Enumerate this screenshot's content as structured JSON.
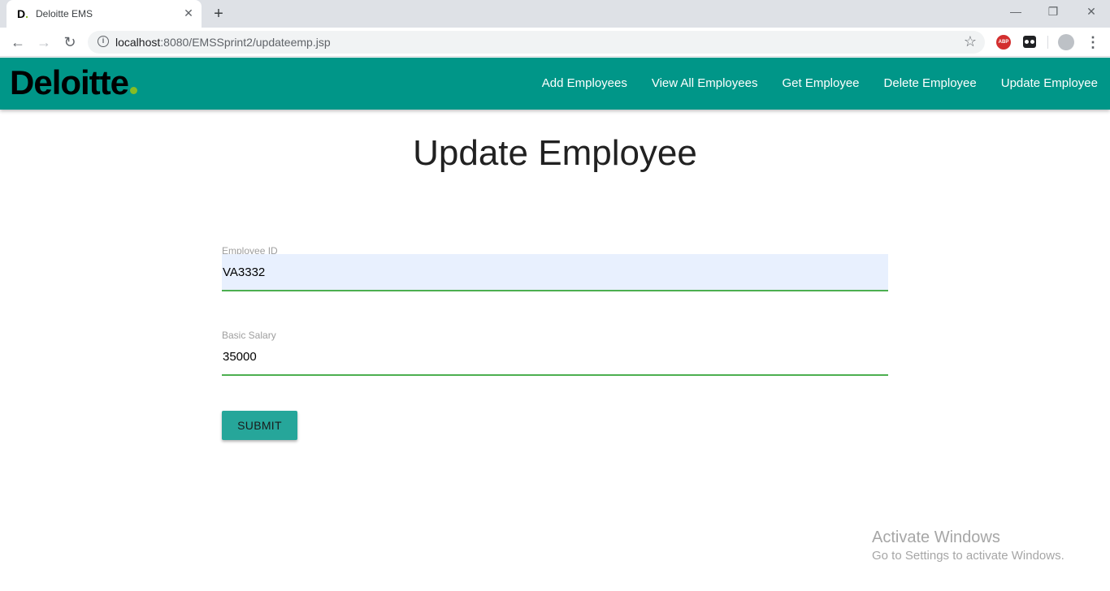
{
  "browser": {
    "tab_favicon": "D",
    "tab_title": "Deloitte EMS",
    "new_tab_label": "+",
    "url_host": "localhost",
    "url_path": ":8080/EMSSprint2/updateemp.jsp",
    "extension_badge": "ABP"
  },
  "navbar": {
    "brand": "Deloitte",
    "brand_dot_color": "#86bc25",
    "background_color": "#009688",
    "links": [
      {
        "label": "Add Employees"
      },
      {
        "label": "View All Employees"
      },
      {
        "label": "Get Employee"
      },
      {
        "label": "Delete Employee"
      },
      {
        "label": "Update Employee"
      }
    ]
  },
  "main": {
    "title": "Update Employee",
    "fields": [
      {
        "label": "Employee ID",
        "value": "VA3332"
      },
      {
        "label": "Basic Salary",
        "value": "35000"
      }
    ],
    "submit_label": "SUBMIT",
    "accent_color": "#26a69a",
    "underline_color": "#4caf50"
  },
  "watermark": {
    "title": "Activate Windows",
    "subtitle": "Go to Settings to activate Windows."
  }
}
